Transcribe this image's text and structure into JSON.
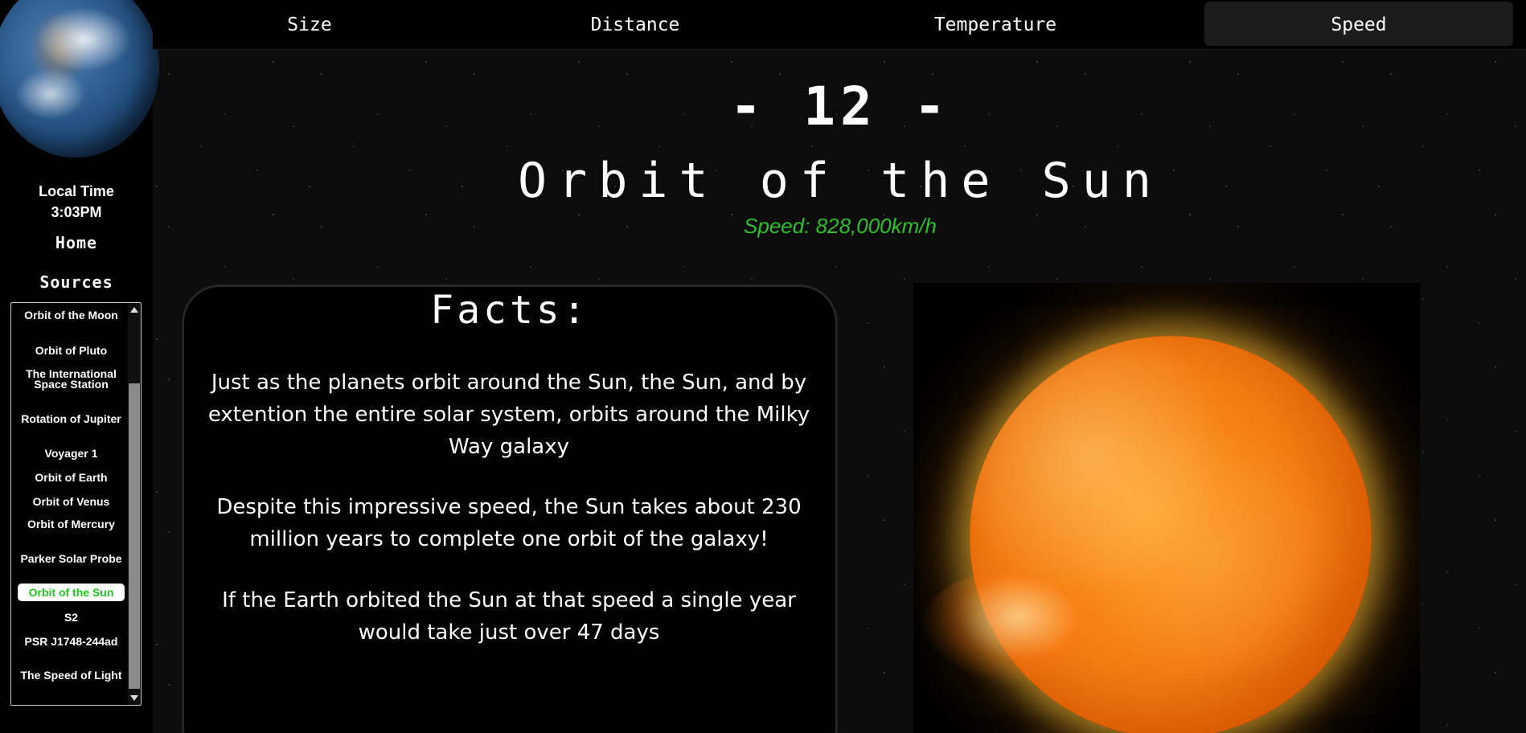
{
  "nav": {
    "tabs": [
      {
        "label": "Size",
        "active": false
      },
      {
        "label": "Distance",
        "active": false
      },
      {
        "label": "Temperature",
        "active": false
      },
      {
        "label": "Speed",
        "active": true
      }
    ]
  },
  "sidebar": {
    "local_time_label": "Local Time",
    "local_time_value": "3:03PM",
    "home": "Home",
    "sources": "Sources",
    "items": [
      "Orbit of the Moon",
      "Orbit of Pluto",
      "The International Space Station",
      "Rotation of Jupiter",
      "Voyager 1",
      "Orbit of Earth",
      "Orbit of Venus",
      "Orbit of Mercury",
      "Parker Solar Probe",
      "Orbit of the Sun",
      "S2",
      "PSR J1748-244ad",
      "The Speed of Light"
    ],
    "active_item": "Orbit of the Sun"
  },
  "main": {
    "number": "- 12 -",
    "title": "Orbit of the Sun",
    "speed": "Speed: 828,000km/h",
    "speed_color": "#2cc02c",
    "facts_title": "Facts:",
    "facts": [
      "Just as the planets orbit around the Sun, the Sun, and by extention the entire solar system, orbits around the Milky Way galaxy",
      "Despite this impressive speed, the Sun takes about 230 million years to complete one orbit of the galaxy!",
      "If the Earth orbited the Sun at that speed a single year would take just over 47 days"
    ]
  },
  "colors": {
    "background": "#000000",
    "active_item_text": "#1fc51f",
    "active_tab_bg": "#1c1c1c"
  }
}
